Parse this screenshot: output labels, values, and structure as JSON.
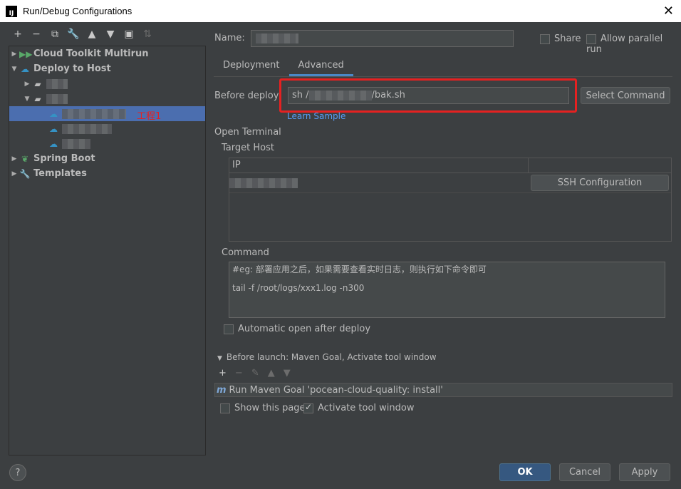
{
  "window": {
    "title": "Run/Debug Configurations",
    "app_icon_text": "IJ"
  },
  "left_toolbar": {
    "add": "+",
    "remove": "−",
    "copy": "⧉",
    "edit": "🔧",
    "up": "▲",
    "down": "▼",
    "folder": "▣",
    "sort": "⇅"
  },
  "tree": {
    "items": [
      {
        "label": "Cloud Toolkit Multirun",
        "icon": "double-play-icon"
      },
      {
        "label": "Deploy to Host",
        "icon": "cloud-upload-icon"
      },
      {
        "label": "Spring Boot",
        "icon": "spring-boot-icon"
      },
      {
        "label": "Templates",
        "icon": "wrench-icon"
      }
    ],
    "annotation": "工程1"
  },
  "form": {
    "name_label": "Name:",
    "share_label": "Share",
    "parallel_label": "Allow parallel run",
    "tabs": [
      "Deployment",
      "Advanced"
    ],
    "active_tab": "Advanced",
    "before_deploy_label": "Before deploy",
    "before_deploy_prefix": "sh /",
    "before_deploy_suffix": "/bak.sh",
    "select_command_label": "Select Command",
    "learn_sample_label": "Learn Sample",
    "open_terminal_label": "Open Terminal",
    "target_host_label": "Target Host",
    "ip_header": "IP",
    "ssh_config_label": "SSH Configuration",
    "command_label": "Command",
    "command_line1": "#eg: 部署应用之后，如果需要查看实时日志，则执行如下命令即可",
    "command_line2": "tail -f /root/logs/xxx1.log -n300",
    "auto_open_label": "Automatic open after deploy",
    "before_launch_label": "Before launch: Maven Goal, Activate tool window",
    "maven_goal_icon": "m",
    "maven_goal": "Run Maven Goal 'pocean-cloud-quality: install'",
    "show_page_label": "Show this page",
    "activate_tool_label": "Activate tool window"
  },
  "buttons": {
    "ok": "OK",
    "cancel": "Cancel",
    "apply": "Apply",
    "help": "?"
  },
  "colors": {
    "accent": "#4b6eaf",
    "highlight_border": "#e52121",
    "link": "#589df6"
  }
}
